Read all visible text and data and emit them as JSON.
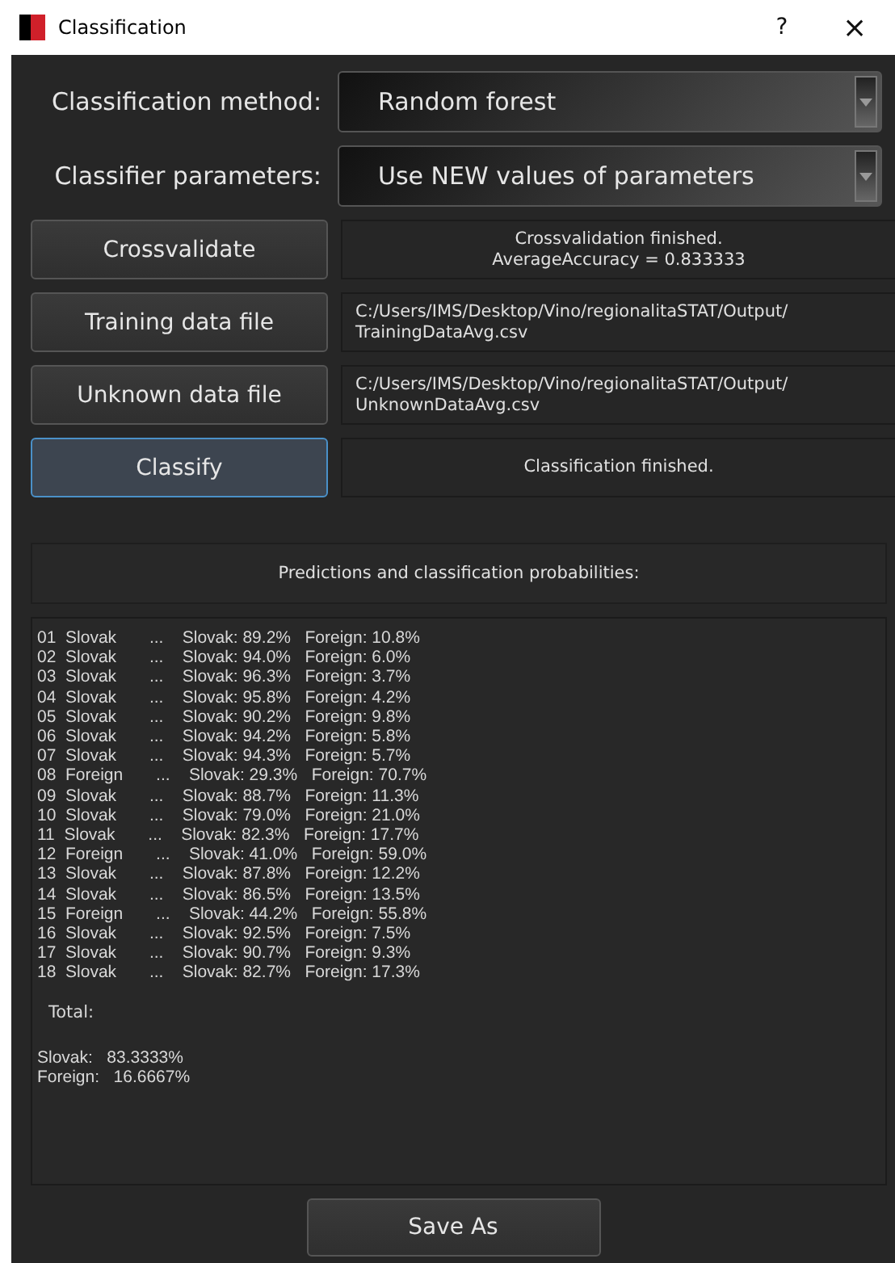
{
  "window": {
    "title": "Classification",
    "help": "?",
    "close": "×"
  },
  "settings": [
    {
      "label": "Classification method:",
      "value": "Random forest"
    },
    {
      "label": "Classifier parameters:",
      "value": "Use NEW values of parameters"
    }
  ],
  "actions": [
    {
      "button": "Crossvalidate",
      "focused": false,
      "kind": "message",
      "lines": [
        "Crossvalidation finished.",
        "AverageAccuracy = 0.833333"
      ]
    },
    {
      "button": "Training data file",
      "focused": false,
      "kind": "path",
      "lines": [
        "C:/Users/IMS/Desktop/Vino/regionalitaSTAT/Output/",
        "TrainingDataAvg.csv"
      ]
    },
    {
      "button": "Unknown data file",
      "focused": false,
      "kind": "path",
      "lines": [
        "C:/Users/IMS/Desktop/Vino/regionalitaSTAT/Output/",
        "UnknownDataAvg.csv"
      ]
    },
    {
      "button": "Classify",
      "focused": true,
      "kind": "message",
      "lines": [
        "Classification finished."
      ]
    }
  ],
  "results_header": "Predictions and classification probabilities:",
  "results": [
    "01  Slovak       ...    Slovak: 89.2%   Foreign: 10.8%",
    "02  Slovak       ...    Slovak: 94.0%   Foreign: 6.0%",
    "03  Slovak       ...    Slovak: 96.3%   Foreign: 3.7%",
    "04  Slovak       ...    Slovak: 95.8%   Foreign: 4.2%",
    "05  Slovak       ...    Slovak: 90.2%   Foreign: 9.8%",
    "06  Slovak       ...    Slovak: 94.2%   Foreign: 5.8%",
    "07  Slovak       ...    Slovak: 94.3%   Foreign: 5.7%",
    "08  Foreign       ...    Slovak: 29.3%   Foreign: 70.7%",
    "09  Slovak       ...    Slovak: 88.7%   Foreign: 11.3%",
    "10  Slovak       ...    Slovak: 79.0%   Foreign: 21.0%",
    "11  Slovak       ...    Slovak: 82.3%   Foreign: 17.7%",
    "12  Foreign       ...    Slovak: 41.0%   Foreign: 59.0%",
    "13  Slovak       ...    Slovak: 87.8%   Foreign: 12.2%",
    "14  Slovak       ...    Slovak: 86.5%   Foreign: 13.5%",
    "15  Foreign       ...    Slovak: 44.2%   Foreign: 55.8%",
    "16  Slovak       ...    Slovak: 92.5%   Foreign: 7.5%",
    "17  Slovak       ...    Slovak: 90.7%   Foreign: 9.3%",
    "18  Slovak       ...    Slovak: 82.7%   Foreign: 17.3%"
  ],
  "total_label": "Total:",
  "totals": [
    "Slovak:   83.3333%",
    "Foreign:   16.6667%"
  ],
  "save_button": "Save As"
}
